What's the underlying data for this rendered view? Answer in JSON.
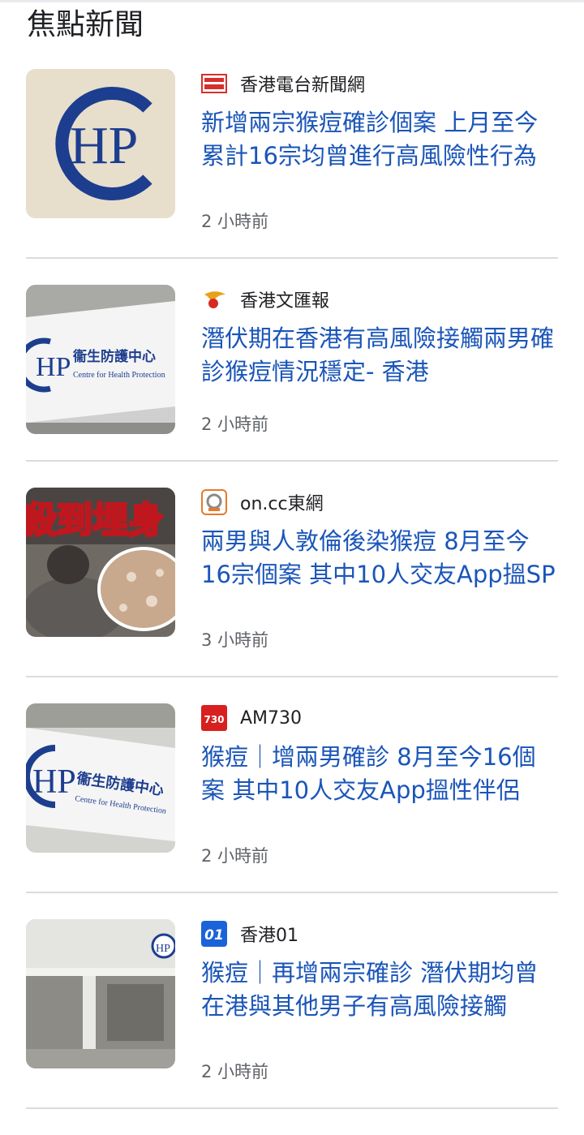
{
  "section": {
    "title": "焦點新聞"
  },
  "articles": [
    {
      "source": "香港電台新聞網",
      "source_logo": "rthk-logo",
      "headline": "新增兩宗猴痘確診個案 上月至今累計16宗均曾進行高風險性行為",
      "time": "2 小時前",
      "thumb": {
        "kind": "chp-logo",
        "alt_text": "HP"
      }
    },
    {
      "source": "香港文匯報",
      "source_logo": "wenweipo-logo",
      "headline": "潛伏期在香港有高風險接觸兩男確診猴痘情況穩定- 香港",
      "time": "2 小時前",
      "thumb": {
        "kind": "chp-sign",
        "alt_text": "HP",
        "sign_cn": "衞生防護中心",
        "sign_en": "Centre for Health Protection"
      }
    },
    {
      "source": "on.cc東網",
      "source_logo": "oncc-logo",
      "headline": "兩男與人敦倫後染猴痘 8月至今16宗個案 其中10人交友App搵SP",
      "time": "3 小時前",
      "thumb": {
        "kind": "rash-photo",
        "overlay_text": "殺到埋身"
      }
    },
    {
      "source": "AM730",
      "source_logo": "am730-logo",
      "source_logo_text": "730",
      "headline": "猴痘｜增兩男確診 8月至今16個案 其中10人交友App搵性伴侶",
      "time": "2 小時前",
      "thumb": {
        "kind": "chp-sign",
        "alt_text": "HP",
        "sign_cn": "衞生防護中心",
        "sign_en": "Centre for Health Protection"
      }
    },
    {
      "source": "香港01",
      "source_logo": "hk01-logo",
      "source_logo_text": "01",
      "headline": "猴痘｜再增兩宗確診 潛伏期均曾在港與其他男子有高風險接觸",
      "time": "2 小時前",
      "thumb": {
        "kind": "building-photo",
        "alt_text": "HP"
      }
    }
  ],
  "colors": {
    "headline": "#1a55b8",
    "time": "#5f6368",
    "divider": "#dadce0",
    "chp_blue": "#1d3e8f"
  }
}
